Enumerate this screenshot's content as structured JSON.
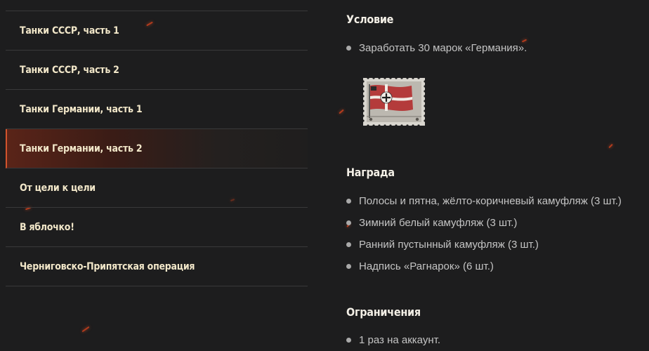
{
  "sidebar": {
    "items": [
      {
        "label": "Танки СССР, часть 1",
        "active": false
      },
      {
        "label": "Танки СССР, часть 2",
        "active": false
      },
      {
        "label": "Танки Германии, часть 1",
        "active": false
      },
      {
        "label": "Танки Германии, часть 2",
        "active": true
      },
      {
        "label": "От цели к цели",
        "active": false
      },
      {
        "label": "В яблочко!",
        "active": false
      },
      {
        "label": "Черниговско-Припятская операция",
        "active": false
      }
    ]
  },
  "condition": {
    "heading": "Условие",
    "items": [
      "Заработать 30 марок «Германия»."
    ],
    "stamp_icon": "germany-flag-stamp-icon"
  },
  "reward": {
    "heading": "Награда",
    "items": [
      "Полосы и пятна, жёлто-коричневый камуфляж (3 шт.)",
      "Зимний белый камуфляж (3 шт.)",
      "Ранний пустынный камуфляж (3 шт.)",
      "Надпись «Рагнарок» (6 шт.)"
    ]
  },
  "limits": {
    "heading": "Ограничения",
    "items": [
      "1 раз на аккаунт."
    ]
  },
  "colors": {
    "background": "#1d1d1e",
    "accent": "#d2542d",
    "sidebar_text": "#f2e7c9",
    "body_text": "#c4c4c4",
    "divider": "#39393a"
  }
}
